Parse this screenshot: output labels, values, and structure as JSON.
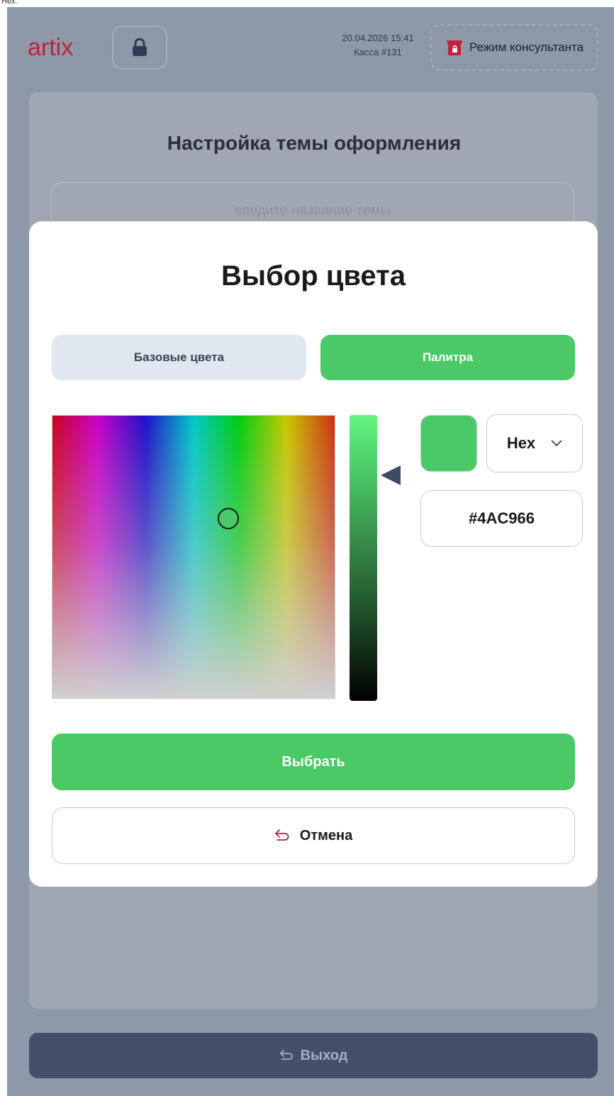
{
  "top_strip": {
    "text": "Hex:"
  },
  "header": {
    "logo_text": "artix",
    "datetime": "20.04.2026 15:41",
    "register": "Касса #131",
    "consultant_mode_label": "Режим консультанта"
  },
  "background": {
    "title": "Настройка темы оформления",
    "theme_name_placeholder": "введите название темы",
    "exit_label": "Выход"
  },
  "modal": {
    "title": "Выбор цвета",
    "tabs": [
      {
        "label": "Базовые цвета",
        "active": false
      },
      {
        "label": "Палитра",
        "active": true
      }
    ],
    "selected_color": "#4AC966",
    "format": "Hex",
    "hex_value": "#4AC966",
    "select_label": "Выбрать",
    "cancel_label": "Отмена"
  },
  "colors": {
    "accent_green": "#4ac966",
    "overlay": "#8d98a8",
    "exit_button": "#44506a",
    "brand_red": "#c0213b"
  },
  "icons": {
    "lock": "lock-icon",
    "consultant": "store-lock-icon",
    "dropdown": "chevron-down-icon",
    "return": "return-arrow-icon"
  }
}
